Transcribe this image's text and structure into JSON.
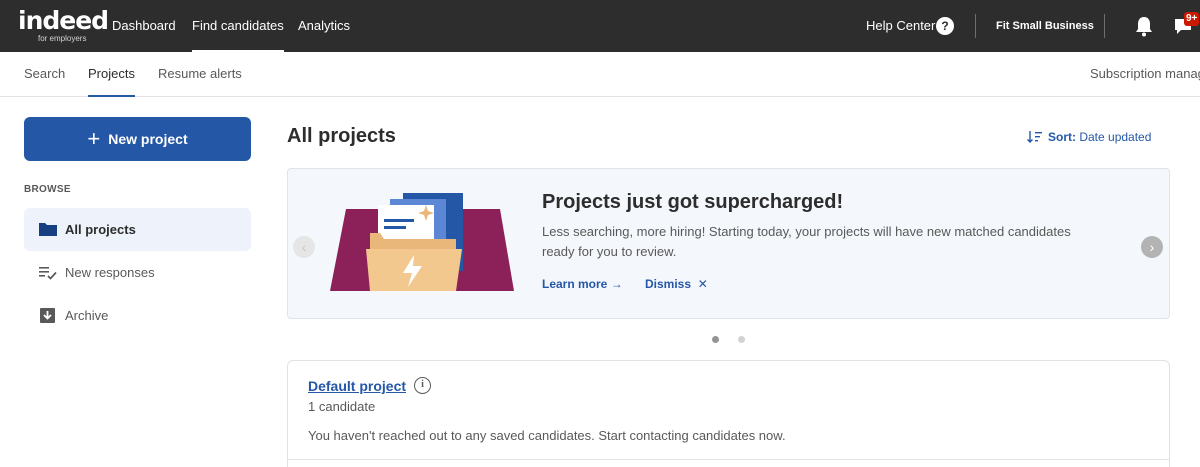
{
  "topbar": {
    "logo_word": "indeed",
    "logo_sub": "for employers",
    "nav": [
      {
        "label": "Dashboard",
        "active": false
      },
      {
        "label": "Find candidates",
        "active": true
      },
      {
        "label": "Analytics",
        "active": false
      }
    ],
    "help_label": "Help Center",
    "help_icon": "?",
    "company": "Fit Small Business",
    "badge": "9+"
  },
  "subnav": {
    "tabs": [
      {
        "label": "Search",
        "active": false
      },
      {
        "label": "Projects",
        "active": true
      },
      {
        "label": "Resume alerts",
        "active": false
      }
    ],
    "right_label": "Subscription manag"
  },
  "sidebar": {
    "new_project_label": "New project",
    "browse_label": "BROWSE",
    "items": [
      {
        "label": "All projects",
        "active": true,
        "icon": "folder-icon"
      },
      {
        "label": "New responses",
        "active": false,
        "icon": "list-check-icon"
      },
      {
        "label": "Archive",
        "active": false,
        "icon": "archive-icon"
      }
    ]
  },
  "main": {
    "title": "All projects",
    "sort_label": "Sort:",
    "sort_value": "Date updated",
    "promo": {
      "title": "Projects just got supercharged!",
      "text": "Less searching, more hiring! Starting today, your projects will have new matched candidates ready for you to review.",
      "learn_more": "Learn more",
      "learn_more_arrow": "→",
      "dismiss": "Dismiss",
      "dismiss_icon": "✕"
    },
    "carousel": {
      "count": 2,
      "active_index": 0
    },
    "project_card": {
      "title": "Default project",
      "count": "1 candidate",
      "message": "You haven't reached out to any saved candidates. Start contacting candidates now."
    }
  },
  "colors": {
    "topbar": "#2d2d2d",
    "primary": "#2557a7",
    "promo_bg": "#f4f7fc",
    "art_purple": "#8c2159",
    "art_folder": "#e9b77a",
    "art_blue": "#2557a7",
    "badge_red": "#c91a00"
  }
}
